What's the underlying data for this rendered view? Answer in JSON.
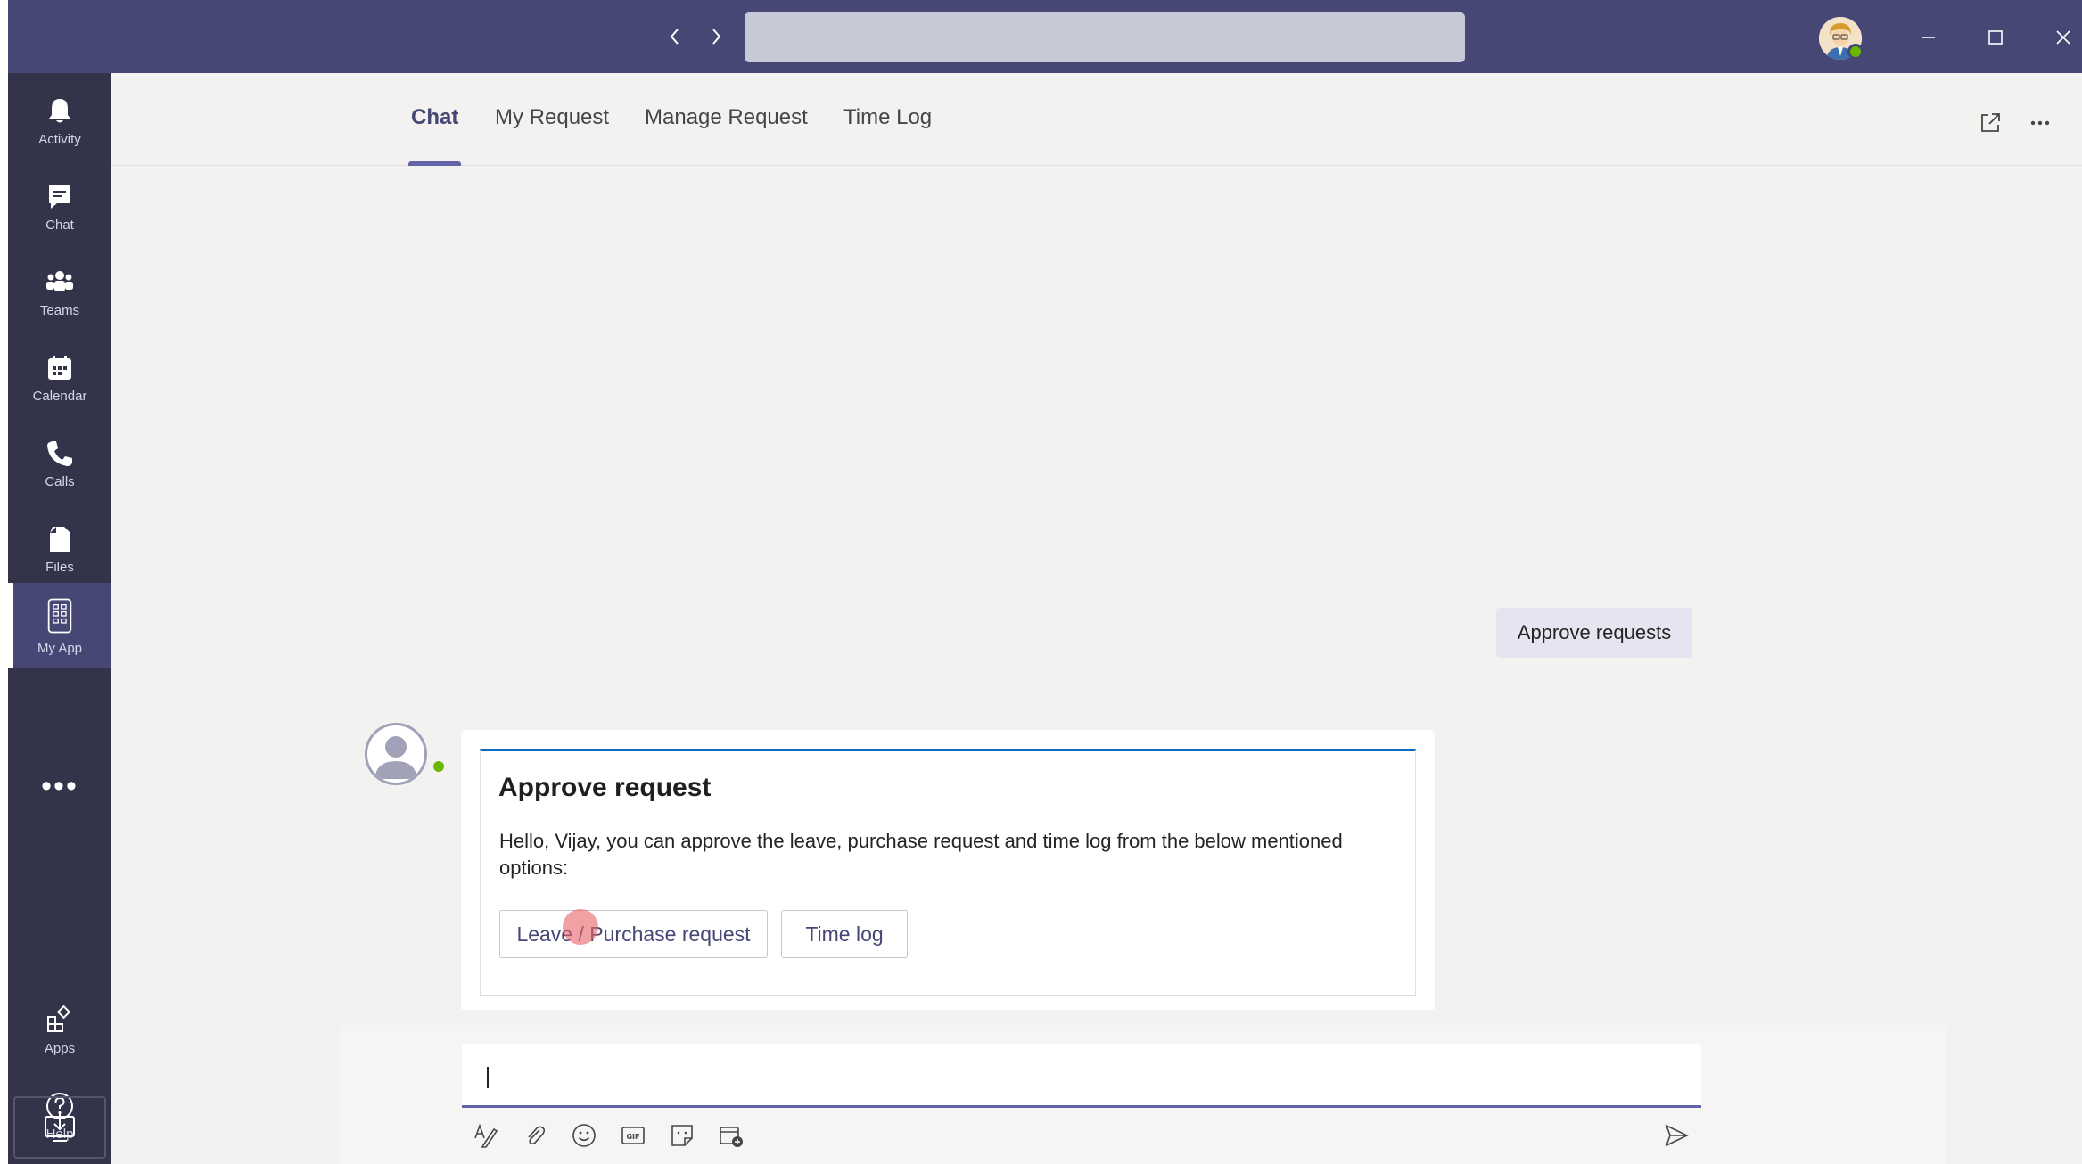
{
  "titlebar": {
    "search_placeholder": "",
    "back_icon": "chevron-left-icon",
    "forward_icon": "chevron-right-icon"
  },
  "rail": {
    "items": [
      {
        "label": "Activity",
        "icon": "bell-icon"
      },
      {
        "label": "Chat",
        "icon": "chat-icon"
      },
      {
        "label": "Teams",
        "icon": "teams-icon"
      },
      {
        "label": "Calendar",
        "icon": "calendar-icon"
      },
      {
        "label": "Calls",
        "icon": "phone-icon"
      },
      {
        "label": "Files",
        "icon": "file-icon"
      },
      {
        "label": "My App",
        "icon": "app-icon",
        "active": true
      }
    ],
    "more": "•••",
    "bottom_items": [
      {
        "label": "Apps",
        "icon": "apps-icon"
      },
      {
        "label": "Help",
        "icon": "help-icon"
      }
    ]
  },
  "tabs": [
    {
      "label": "Chat",
      "active": true
    },
    {
      "label": "My Request"
    },
    {
      "label": "Manage Request"
    },
    {
      "label": "Time Log"
    }
  ],
  "chat": {
    "sent_message": "Approve requests",
    "card": {
      "title": "Approve request",
      "text": "Hello, Vijay, you can approve the leave, purchase request and time log from the below mentioned options:",
      "buttons": [
        "Leave / Purchase request",
        "Time log"
      ]
    }
  },
  "compose": {
    "value": "",
    "placeholder": ""
  },
  "colors": {
    "titlebar": "#464775",
    "rail": "#33344a",
    "accent": "#6264a7",
    "status_available": "#6bb700",
    "card_accent": "#0f6cbd"
  }
}
